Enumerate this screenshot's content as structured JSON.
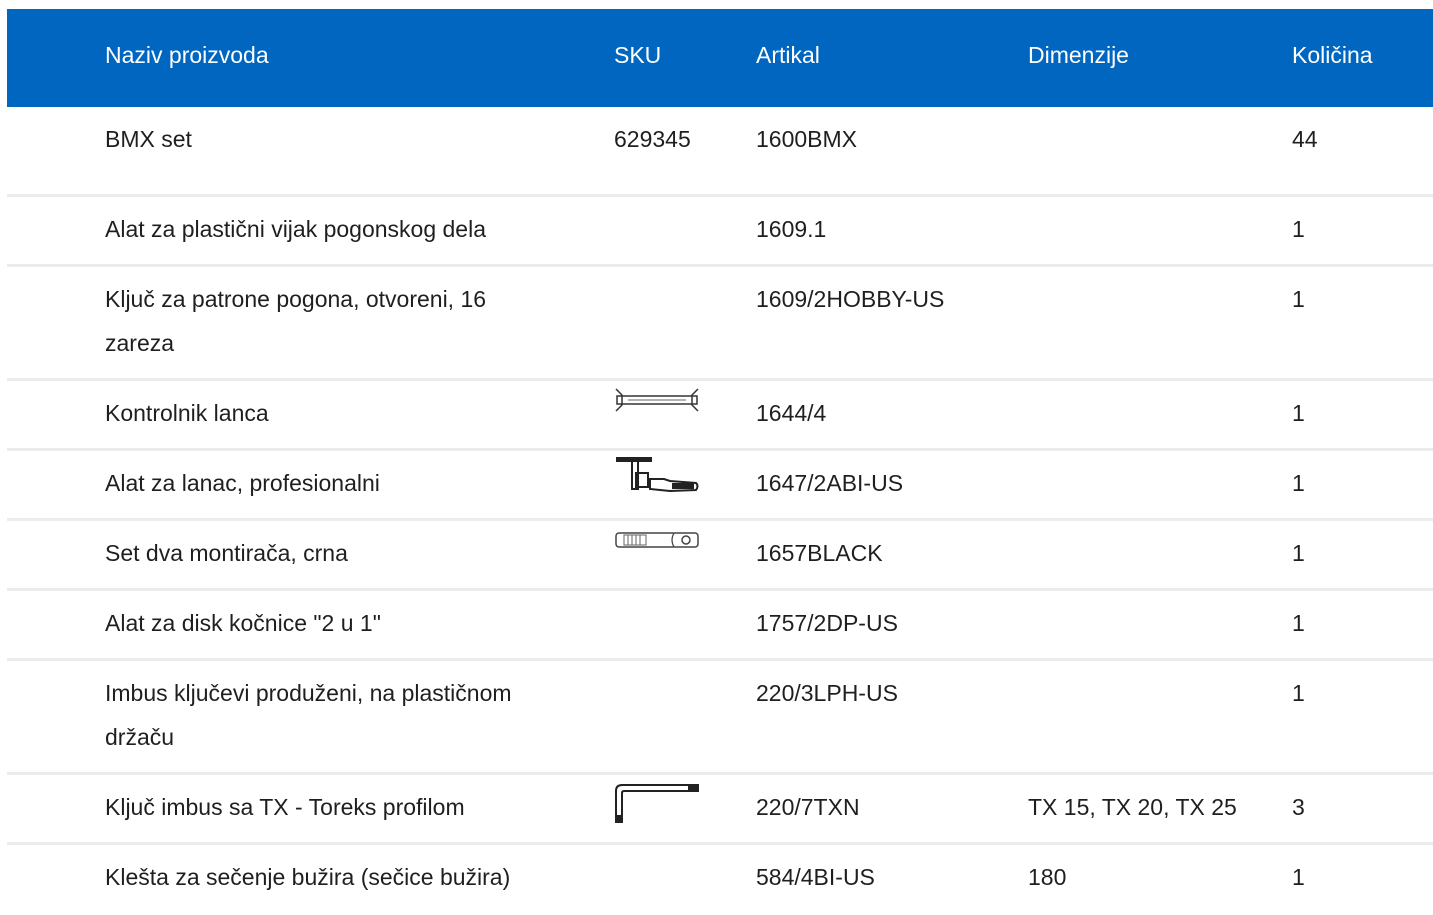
{
  "table": {
    "headers": {
      "name": "Naziv proizvoda",
      "sku": "SKU",
      "article": "Artikal",
      "dimensions": "Dimenzije",
      "quantity": "Količina"
    },
    "rows": [
      {
        "name": "BMX set",
        "sku": "629345",
        "article": "1600BMX",
        "dimensions": "",
        "quantity": "44",
        "image": ""
      },
      {
        "name": "Alat za plastični vijak pogonskog dela",
        "sku": "",
        "article": "1609.1",
        "dimensions": "",
        "quantity": "1",
        "image": ""
      },
      {
        "name": "Ključ za patrone pogona, otvoreni, 16 zareza",
        "sku": "",
        "article": "1609/2HOBBY-US",
        "dimensions": "",
        "quantity": "1",
        "image": ""
      },
      {
        "name": "Kontrolnik lanca",
        "sku": "",
        "article": "1644/4",
        "dimensions": "",
        "quantity": "1",
        "image": "chain-checker-icon"
      },
      {
        "name": "Alat za lanac, profesionalni",
        "sku": "",
        "article": "1647/2ABI-US",
        "dimensions": "",
        "quantity": "1",
        "image": "chain-tool-icon"
      },
      {
        "name": "Set dva montirača, crna",
        "sku": "",
        "article": "1657BLACK",
        "dimensions": "",
        "quantity": "1",
        "image": "tire-lever-icon"
      },
      {
        "name": "Alat za disk kočnice \"2 u 1\"",
        "sku": "",
        "article": "1757/2DP-US",
        "dimensions": "",
        "quantity": "1",
        "image": ""
      },
      {
        "name": "Imbus ključevi produženi, na plastičnom držaču",
        "sku": "",
        "article": "220/3LPH-US",
        "dimensions": "",
        "quantity": "1",
        "image": ""
      },
      {
        "name": "Ključ imbus sa TX - Toreks profilom",
        "sku": "",
        "article": "220/7TXN",
        "dimensions": "TX 15, TX 20, TX 25",
        "quantity": "3",
        "image": "torx-key-icon"
      },
      {
        "name": "Klešta za sečenje bužira (sečice bužira)",
        "sku": "",
        "article": "584/4BI-US",
        "dimensions": "180",
        "quantity": "1",
        "image": ""
      }
    ]
  }
}
